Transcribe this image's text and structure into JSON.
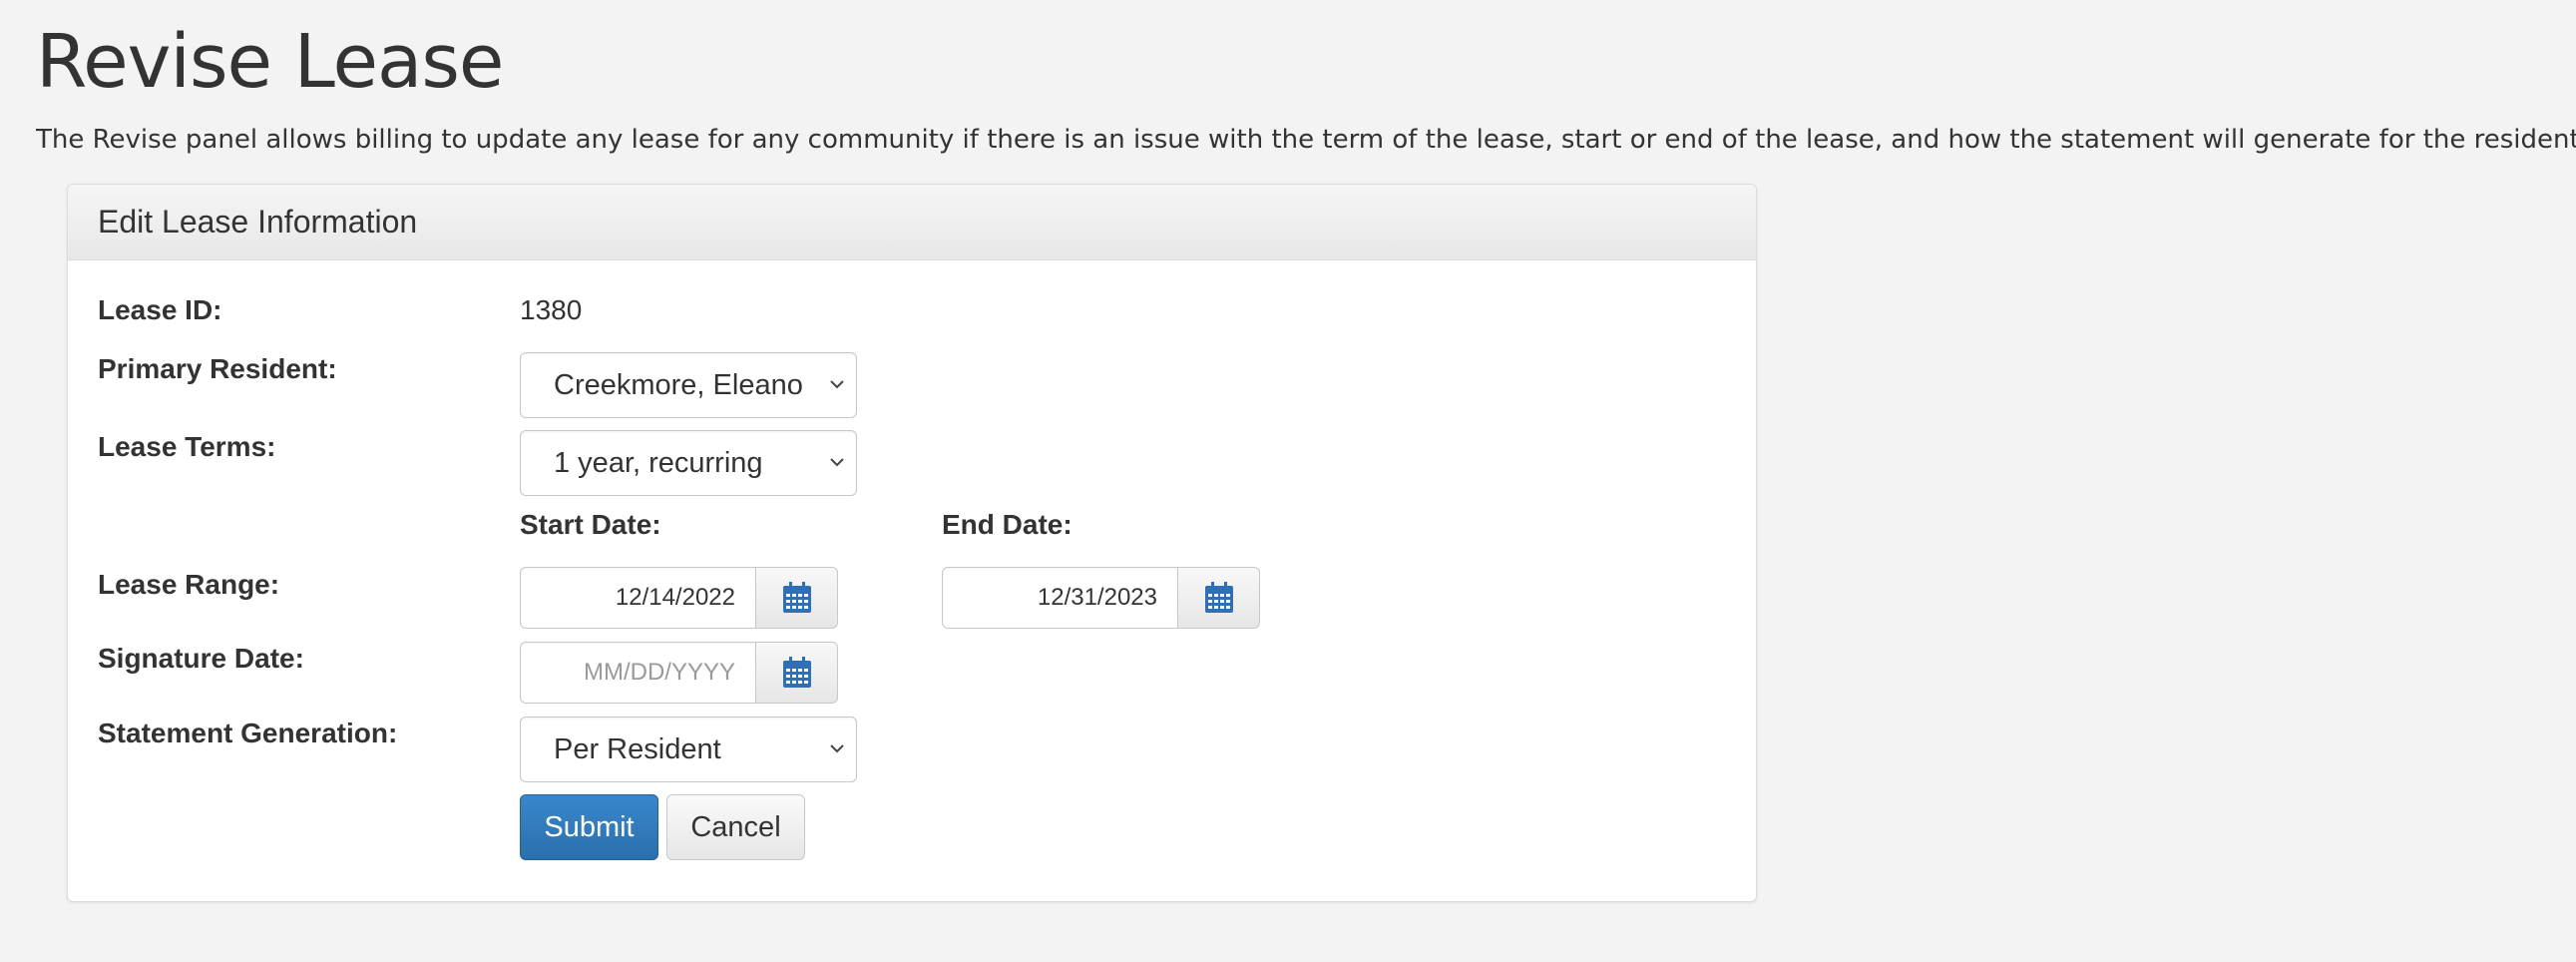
{
  "page": {
    "title": "Revise Lease",
    "description": "The Revise panel allows billing to update any lease for any community if there is an issue with the term of the lease, start or end of the lease, and how the statement will generate for the residents"
  },
  "panel": {
    "heading": "Edit Lease Information"
  },
  "form": {
    "lease_id_label": "Lease ID:",
    "lease_id_value": "1380",
    "primary_resident_label": "Primary Resident:",
    "primary_resident_value": "Creekmore, Eleanor",
    "lease_terms_label": "Lease Terms:",
    "lease_terms_value": "1 year, recurring",
    "start_date_label": "Start Date:",
    "end_date_label": "End Date:",
    "lease_range_label": "Lease Range:",
    "start_date_value": "12/14/2022",
    "end_date_value": "12/31/2023",
    "signature_date_label": "Signature Date:",
    "signature_date_placeholder": "MM/DD/YYYY",
    "statement_generation_label": "Statement Generation:",
    "statement_generation_value": "Per Resident",
    "submit_label": "Submit",
    "cancel_label": "Cancel"
  },
  "icons": {
    "calendar": "calendar-icon",
    "dropdown": "chevron-down-icon"
  },
  "colors": {
    "primary_button": "#337ab7",
    "calendar_icon": "#2f6fb5",
    "page_background": "#f3f3f3"
  }
}
